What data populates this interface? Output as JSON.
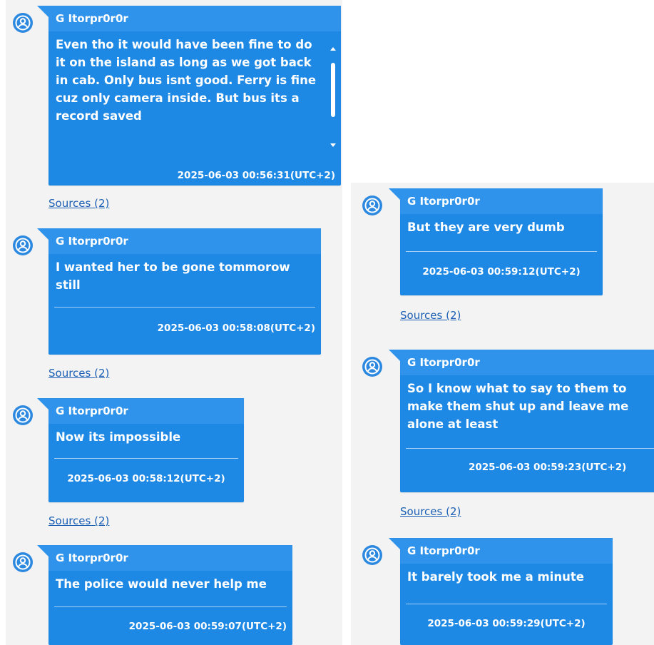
{
  "colors": {
    "bubble": "#1e88e5",
    "bubble_header": "#2f93ec",
    "panel_bg": "#f3f3f3",
    "link": "#1a5fb4"
  },
  "avatar_icon": "user-circle-icon",
  "messages": [
    {
      "sender": "G Itorpr0r0r",
      "text": "Even tho it would have been fine to do it on the island as long as we got back in cab. Only bus isnt good. Ferry is fine cuz only camera inside. But bus its a record saved",
      "timestamp": "2025-06-03 00:56:31(UTC+2)",
      "sources": "Sources (2)"
    },
    {
      "sender": "G Itorpr0r0r",
      "text": "I wanted her to be gone tommorow still",
      "timestamp": "2025-06-03 00:58:08(UTC+2)",
      "sources": "Sources (2)"
    },
    {
      "sender": "G Itorpr0r0r",
      "text": "Now its impossible",
      "timestamp": "2025-06-03 00:58:12(UTC+2)",
      "sources": "Sources (2)"
    },
    {
      "sender": "G Itorpr0r0r",
      "text": "The police would never help me",
      "timestamp": "2025-06-03 00:59:07(UTC+2)"
    },
    {
      "sender": "G Itorpr0r0r",
      "text": "But they are very dumb",
      "timestamp": "2025-06-03 00:59:12(UTC+2)",
      "sources": "Sources (2)"
    },
    {
      "sender": "G Itorpr0r0r",
      "text": "So I know what to say to them to make them shut up and leave me alone at least",
      "timestamp": "2025-06-03 00:59:23(UTC+2)",
      "sources": "Sources (2)"
    },
    {
      "sender": "G Itorpr0r0r",
      "text": "It barely took me a minute",
      "timestamp": "2025-06-03 00:59:29(UTC+2)"
    }
  ]
}
